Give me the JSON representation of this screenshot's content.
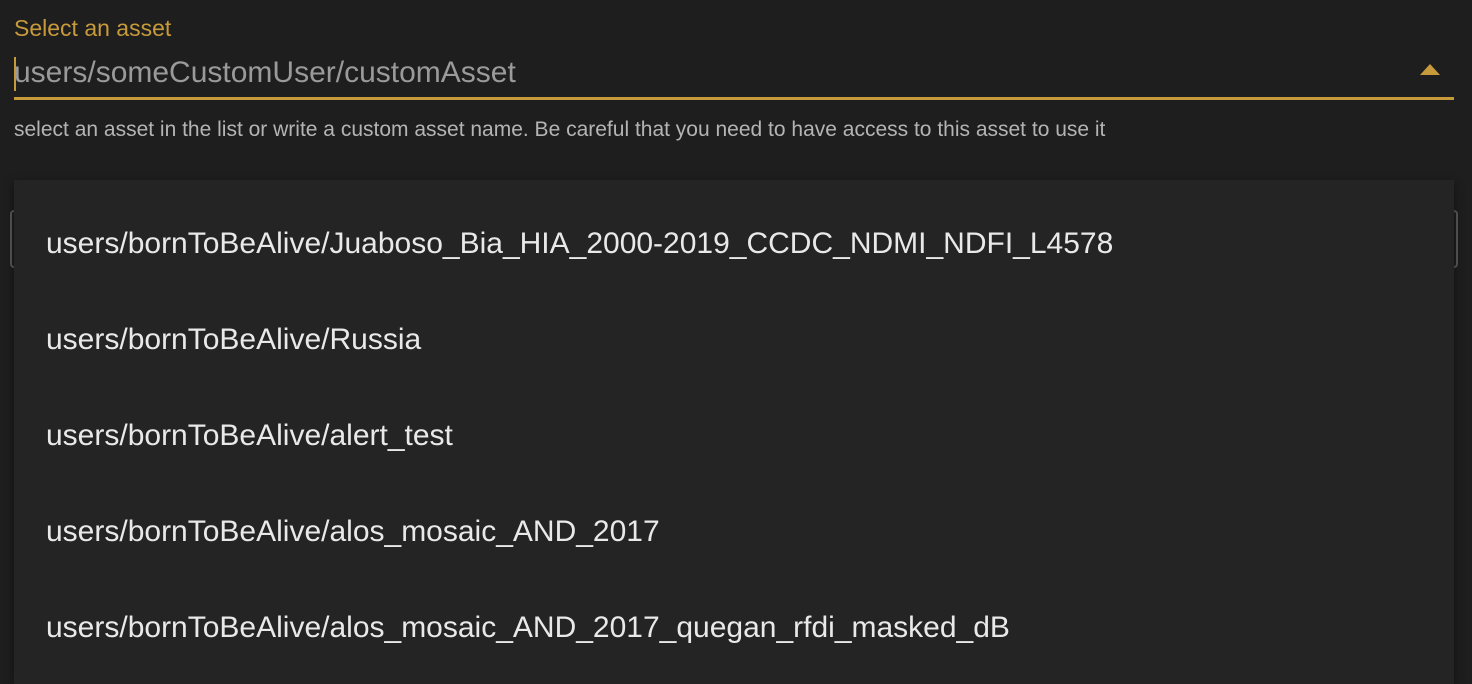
{
  "field": {
    "label": "Select an asset",
    "value": "users/someCustomUser/customAsset",
    "helper": "select an asset in the list or write a custom asset name. Be careful that you need to have access to this asset to use it",
    "dropdown_icon": "caret-up-icon"
  },
  "dropdown": {
    "options": [
      "users/bornToBeAlive/Juaboso_Bia_HIA_2000-2019_CCDC_NDMI_NDFI_L4578",
      "users/bornToBeAlive/Russia",
      "users/bornToBeAlive/alert_test",
      "users/bornToBeAlive/alos_mosaic_AND_2017",
      "users/bornToBeAlive/alos_mosaic_AND_2017_quegan_rfdi_masked_dB"
    ]
  },
  "colors": {
    "accent": "#c79a3b",
    "background": "#1e1e1e",
    "menu_background": "#242424",
    "text": "#e9e9e9",
    "muted_text": "#9a9a9a"
  }
}
